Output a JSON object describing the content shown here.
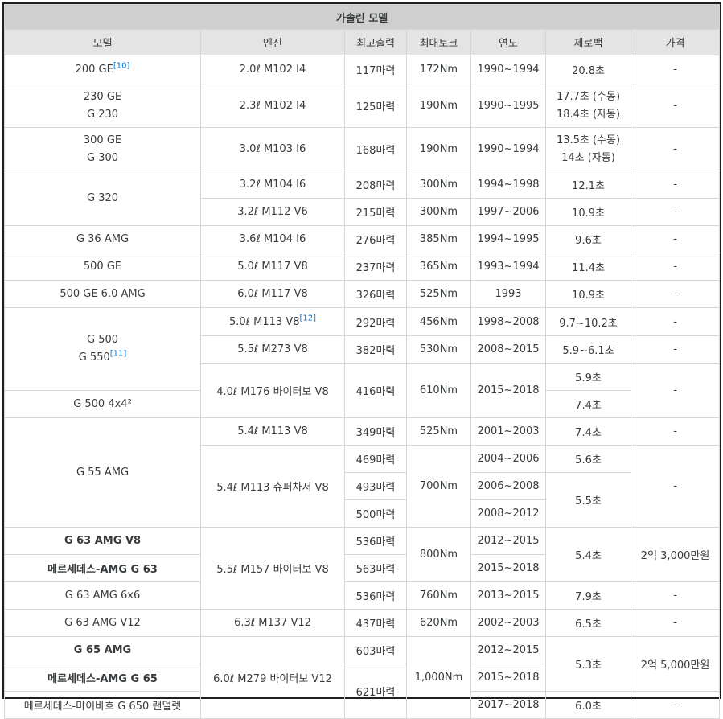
{
  "title": "가솔린 모델",
  "headers": [
    "모델",
    "엔진",
    "최고출력",
    "최대토크",
    "연도",
    "제로백",
    "가격"
  ],
  "rows": {
    "r1": {
      "model": "200 GE",
      "model_ref": "[10]",
      "engine": "2.0ℓ M102 I4",
      "power": "117마력",
      "torque": "172Nm",
      "year": "1990~1994",
      "accel": "20.8초",
      "price": "-"
    },
    "r2": {
      "model_a": "230 GE",
      "model_b": "G 230",
      "engine": "2.3ℓ M102 I4",
      "power": "125마력",
      "torque": "190Nm",
      "year": "1990~1995",
      "accel_a": "17.7초 (수동)",
      "accel_b": "18.4초 (자동)",
      "price": "-"
    },
    "r3": {
      "model_a": "300 GE",
      "model_b": "G 300",
      "engine": "3.0ℓ M103 I6",
      "power": "168마력",
      "torque": "190Nm",
      "year": "1990~1994",
      "accel_a": "13.5초 (수동)",
      "accel_b": "14초 (자동)",
      "price": "-"
    },
    "r4": {
      "model": "G 320",
      "engine": "3.2ℓ M104 I6",
      "power": "208마력",
      "torque": "300Nm",
      "year": "1994~1998",
      "accel": "12.1초",
      "price": "-"
    },
    "r5": {
      "engine": "3.2ℓ M112 V6",
      "power": "215마력",
      "torque": "300Nm",
      "year": "1997~2006",
      "accel": "10.9초",
      "price": "-"
    },
    "r6": {
      "model": "G 36 AMG",
      "engine": "3.6ℓ M104 I6",
      "power": "276마력",
      "torque": "385Nm",
      "year": "1994~1995",
      "accel": "9.6초",
      "price": "-"
    },
    "r7": {
      "model": "500 GE",
      "engine": "5.0ℓ M117 V8",
      "power": "237마력",
      "torque": "365Nm",
      "year": "1993~1994",
      "accel": "11.4초",
      "price": "-"
    },
    "r8": {
      "model": "500 GE 6.0 AMG",
      "engine": "6.0ℓ M117 V8",
      "power": "326마력",
      "torque": "525Nm",
      "year": "1993",
      "accel": "10.9초",
      "price": "-"
    },
    "r9": {
      "model_a": "G 500",
      "model_b": "G 550",
      "model_b_ref": "[11]",
      "engine": "5.0ℓ M113 V8",
      "engine_ref": "[12]",
      "power": "292마력",
      "torque": "456Nm",
      "year": "1998~2008",
      "accel": "9.7~10.2초",
      "price": "-"
    },
    "r10": {
      "engine": "5.5ℓ M273 V8",
      "power": "382마력",
      "torque": "530Nm",
      "year": "2008~2015",
      "accel": "5.9~6.1초",
      "price": "-"
    },
    "r11": {
      "engine": "4.0ℓ M176 바이터보 V8",
      "power": "416마력",
      "torque": "610Nm",
      "year": "2015~2018",
      "accel": "5.9초",
      "price": "-"
    },
    "r12": {
      "model": "G 500 4x4²",
      "accel": "7.4초"
    },
    "r13": {
      "model": "G 55 AMG",
      "engine": "5.4ℓ M113 V8",
      "power": "349마력",
      "torque": "525Nm",
      "year": "2001~2003",
      "accel": "7.4초",
      "price": "-"
    },
    "r14": {
      "engine": "5.4ℓ M113 슈퍼차저 V8",
      "power": "469마력",
      "torque": "700Nm",
      "year": "2004~2006",
      "accel": "5.6초",
      "price": "-"
    },
    "r15": {
      "power": "493마력",
      "year": "2006~2008",
      "accel": "5.5초"
    },
    "r16": {
      "power": "500마력",
      "year": "2008~2012"
    },
    "r17": {
      "model": "G 63 AMG V8",
      "engine": "5.5ℓ M157 바이터보 V8",
      "power": "536마력",
      "torque": "800Nm",
      "year": "2012~2015",
      "accel": "5.4초",
      "price": "2억 3,000만원"
    },
    "r18": {
      "model": "메르세데스-AMG G 63",
      "power": "563마력",
      "year": "2015~2018"
    },
    "r19": {
      "model": "G 63 AMG 6x6",
      "power": "536마력",
      "torque": "760Nm",
      "year": "2013~2015",
      "accel": "7.9초",
      "price": "-"
    },
    "r20": {
      "model": "G 63 AMG V12",
      "engine": "6.3ℓ M137 V12",
      "power": "437마력",
      "torque": "620Nm",
      "year": "2002~2003",
      "accel": "6.5초",
      "price": "-"
    },
    "r21": {
      "model": "G 65 AMG",
      "engine": "6.0ℓ M279 바이터보 V12",
      "power": "603마력",
      "torque": "1,000Nm",
      "year": "2012~2015",
      "accel": "5.3초",
      "price": "2억 5,000만원"
    },
    "r22": {
      "model": "메르세데스-AMG G 65",
      "power": "621마력",
      "year": "2015~2018"
    },
    "r23": {
      "model": "메르세데스-마이바흐 G 650 랜덜렛",
      "year": "2017~2018",
      "accel": "6.0초",
      "price": "-"
    }
  }
}
